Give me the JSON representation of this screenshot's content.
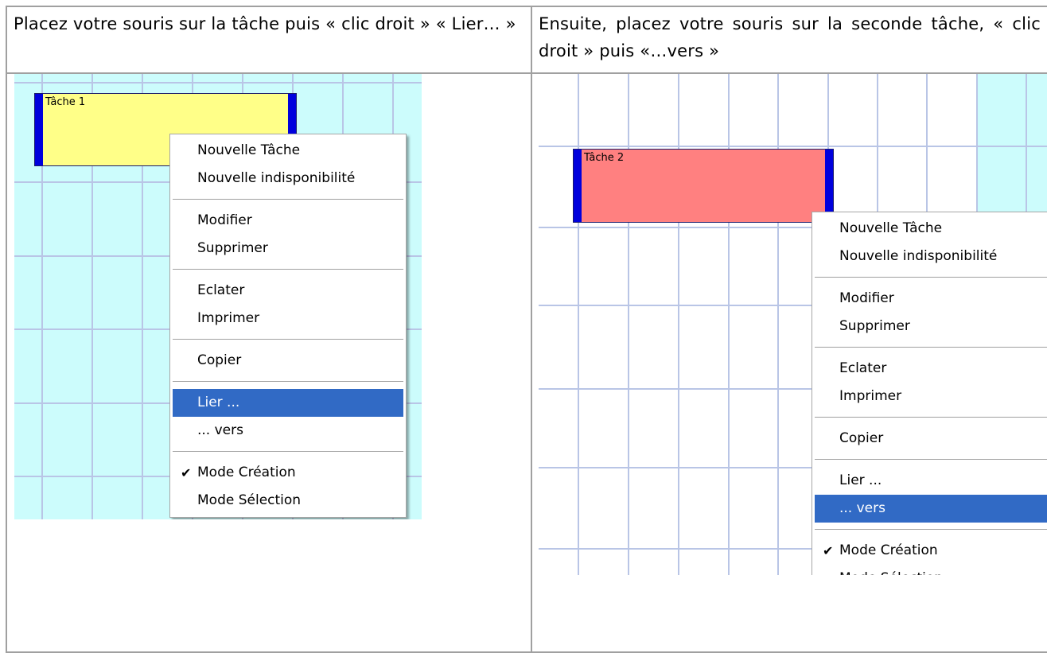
{
  "instructions": {
    "left": "Placez votre souris sur la tâche puis « clic droit » « Lier… »",
    "right": "Ensuite, placez votre souris sur la seconde tâche, « clic droit » puis «…vers »"
  },
  "left_screenshot": {
    "task_label": "Tâche 1",
    "task_color": "#ffff88",
    "menu": {
      "items": [
        {
          "label": "Nouvelle Tâche"
        },
        {
          "label": "Nouvelle indisponibilité"
        },
        {
          "label": "Modifier"
        },
        {
          "label": "Supprimer"
        },
        {
          "label": "Eclater"
        },
        {
          "label": "Imprimer"
        },
        {
          "label": "Copier"
        },
        {
          "label": "Lier ...",
          "selected": true
        },
        {
          "label": "... vers"
        },
        {
          "label": "Mode Création",
          "checked": true
        },
        {
          "label": "Mode Sélection"
        }
      ]
    }
  },
  "right_screenshot": {
    "task_label": "Tâche 2",
    "task_color": "#ff8080",
    "menu": {
      "items": [
        {
          "label": "Nouvelle Tâche"
        },
        {
          "label": "Nouvelle indisponibilité"
        },
        {
          "label": "Modifier"
        },
        {
          "label": "Supprimer"
        },
        {
          "label": "Eclater"
        },
        {
          "label": "Imprimer"
        },
        {
          "label": "Copier"
        },
        {
          "label": "Lier ..."
        },
        {
          "label": "... vers",
          "selected": true
        },
        {
          "label": "Mode Création",
          "checked": true
        },
        {
          "label": "Mode Sélection"
        }
      ]
    }
  },
  "colors": {
    "grid_background": "#ccfcfc",
    "grid_line": "#b9c5e6",
    "selection": "#316ac5",
    "handle": "#0000dd"
  },
  "icons": {
    "check": "check-icon"
  }
}
